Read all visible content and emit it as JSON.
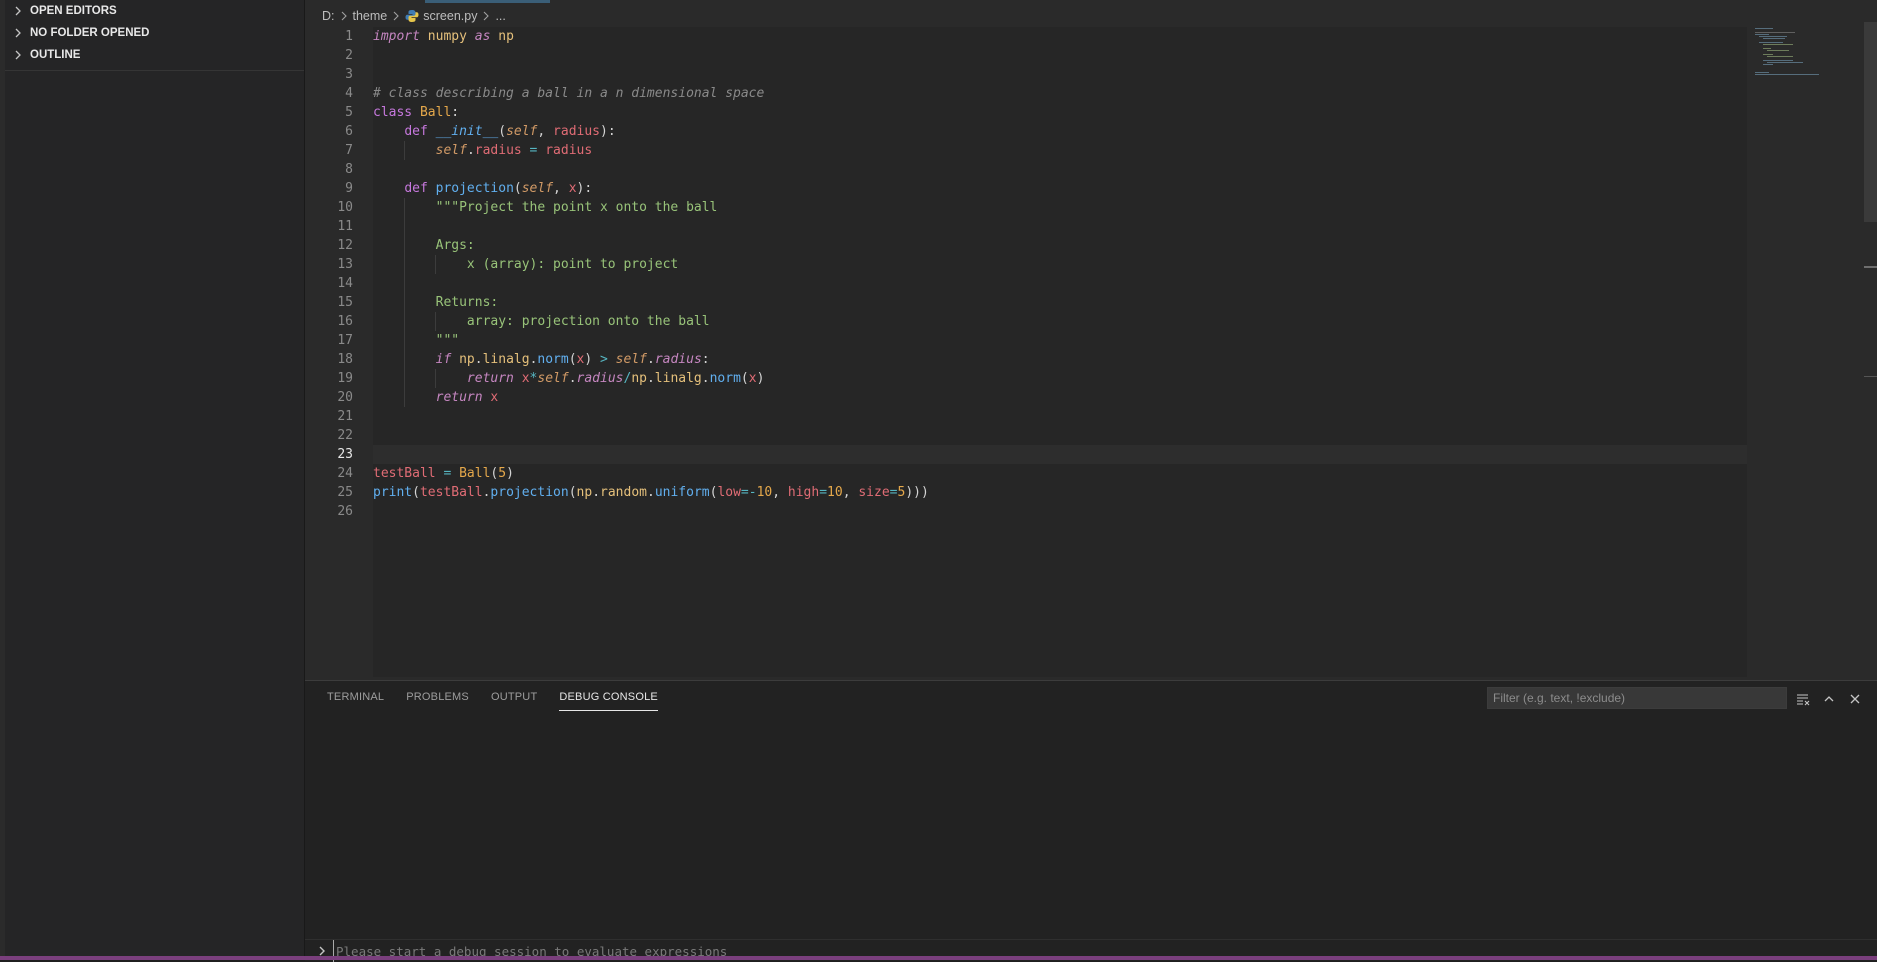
{
  "sidebar": {
    "sections": [
      {
        "label": "OPEN EDITORS"
      },
      {
        "label": "NO FOLDER OPENED"
      },
      {
        "label": "OUTLINE"
      }
    ]
  },
  "breadcrumb": {
    "drive": "D:",
    "folder": "theme",
    "file": "screen.py",
    "more": "..."
  },
  "editor": {
    "current_line": 23,
    "line_numbers": [
      "1",
      "2",
      "3",
      "4",
      "5",
      "6",
      "7",
      "8",
      "9",
      "10",
      "11",
      "12",
      "13",
      "14",
      "15",
      "16",
      "17",
      "18",
      "19",
      "20",
      "21",
      "22",
      "23",
      "24",
      "25",
      "26"
    ],
    "code": {
      "import": "import",
      "numpy": "numpy",
      "as": "as",
      "np": "np",
      "comment": "# class describing a ball in a n dimensional space",
      "class_kw": "class",
      "class_name": "Ball",
      "colon": ":",
      "def": "def",
      "init": "__init__",
      "self": "self",
      "radius": "radius",
      "attr_radius": "radius",
      "assign": " = ",
      "projection": "projection",
      "x": "x",
      "doc_open": "\"\"\"Project the point x onto the ball",
      "doc_args": "Args:",
      "doc_arg_x": "x (array): point to project",
      "doc_returns": "Returns:",
      "doc_ret_desc": "array: projection onto the ball",
      "doc_close": "\"\"\"",
      "if": "if",
      "linalg": "linalg",
      "norm": "norm",
      "gt": " > ",
      "return": "return",
      "star": "*",
      "slash": "/",
      "testBall": "testBall",
      "ball_call_num": "5",
      "print": "print",
      "random": "random",
      "uniform": "uniform",
      "low": "low",
      "neg": "=-",
      "ten": "10",
      "high": "high",
      "eq": "=",
      "size": "size",
      "five": "5"
    }
  },
  "panel": {
    "tabs": [
      {
        "label": "TERMINAL"
      },
      {
        "label": "PROBLEMS"
      },
      {
        "label": "OUTPUT"
      },
      {
        "label": "DEBUG CONSOLE"
      }
    ],
    "filter_placeholder": "Filter (e.g. text, !exclude)",
    "repl_placeholder": "Please start a debug session to evaluate expressions"
  },
  "colors": {
    "accent": "#7a3f7d",
    "keyword": "#c586c0",
    "string": "#98c379",
    "function": "#61afef"
  }
}
